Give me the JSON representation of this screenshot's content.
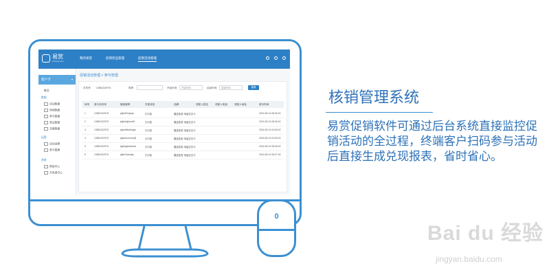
{
  "app": {
    "logo_text": "易赏",
    "logo_sub": "yishang.com"
  },
  "nav": [
    "我的易赏",
    "促销奖品管理",
    "促销活动管理"
  ],
  "breadcrumb": "促销活动管理 > 参与管理",
  "sidebar": {
    "header": "客户卡",
    "items": [
      {
        "label": "概况",
        "type": "item"
      },
      {
        "label": "数据",
        "type": "group"
      },
      {
        "label": "活动数据",
        "type": "item"
      },
      {
        "label": "场地数据",
        "type": "item"
      },
      {
        "label": "参与数据",
        "type": "item"
      },
      {
        "label": "奖品数据",
        "type": "item"
      },
      {
        "label": "兑换数据",
        "type": "item"
      },
      {
        "label": "运营",
        "type": "group"
      },
      {
        "label": "活动运营",
        "type": "item"
      },
      {
        "label": "参与管理",
        "type": "item"
      },
      {
        "label": "系统",
        "type": "group"
      },
      {
        "label": "帮助中心",
        "type": "item"
      },
      {
        "label": "开发者中心",
        "type": "item"
      }
    ]
  },
  "filters": {
    "activity_label": "手机号",
    "activity_value": "13581332978",
    "account_label": "昵称",
    "start_label": "开始时间",
    "start_placeholder": "开始时间",
    "end_label": "结束时间",
    "end_placeholder": "结束时间",
    "search_button": "搜索"
  },
  "table": {
    "headers": [
      "序号",
      "参与手机号",
      "微信昵称",
      "兑奖状态",
      "品牌",
      "领奖人姓名",
      "领奖人电话",
      "领奖人地址",
      "参与时间"
    ],
    "rows": [
      [
        "1",
        "13581332978",
        "jiajfsiPsdjsiyu",
        "已中奖",
        "赠送奖券·请留空白卡",
        "",
        "",
        "",
        "2016-05-01 08:06:02"
      ],
      [
        "2",
        "13581332978",
        "jiajfsbdjdsmkF",
        "已中奖",
        "赠送奖券·请留空白卡",
        "",
        "",
        "",
        "2016-05-01 08:06:02"
      ],
      [
        "3",
        "13581332978",
        "jiajsbifdddktgss",
        "已中奖",
        "赠送奖券·请留空白卡",
        "",
        "",
        "",
        "2016-05-01 04:06:02"
      ],
      [
        "4",
        "13581332978",
        "jiajaesurmoiujB",
        "已中奖",
        "赠送奖券·请留空白卡",
        "",
        "",
        "",
        "2016-05-01 04:06:02"
      ],
      [
        "5",
        "13581332978",
        "jiajfiagssbbshar",
        "已中奖",
        "赠送奖券·请留空白卡",
        "",
        "",
        "",
        "2016-05-01 08:06:02"
      ],
      [
        "6",
        "13581332978",
        "jiajfsTiplsdsjs",
        "已中奖",
        "赠送奖券·请留空白卡",
        "",
        "",
        "",
        "2016-05-01 08:07:02"
      ]
    ]
  },
  "promo": {
    "title": "核销管理系统",
    "description": "易赏促销软件可通过后台系统直接监控促销活动的全过程，终端客户扫码参与活动后直接生成兑现报表，省时省心。"
  },
  "mouse_label": "0",
  "watermark": {
    "main": "Bai du 经验",
    "sub": "jingyan.baidu.com"
  },
  "colors": {
    "brand": "#2d80c6",
    "accent": "#3b8fd1",
    "text_blue": "#2d72b8"
  }
}
